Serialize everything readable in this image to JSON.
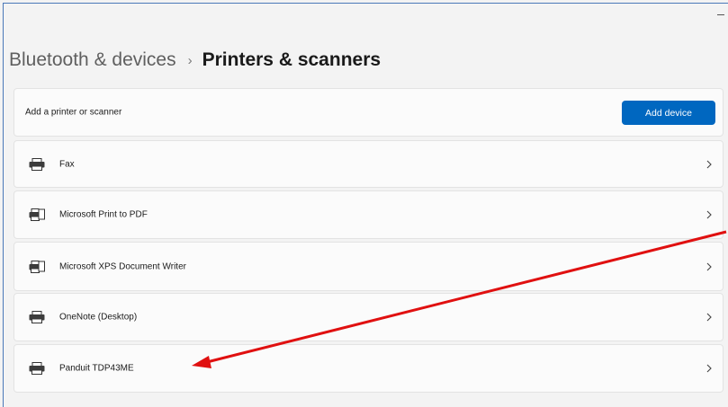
{
  "breadcrumb": {
    "parent": "Bluetooth & devices",
    "separator": "›",
    "current": "Printers & scanners"
  },
  "add_section": {
    "label": "Add a printer or scanner",
    "button_label": "Add device",
    "button_color": "#0067c0"
  },
  "printers": [
    {
      "name": "Fax",
      "icon": "printer-icon"
    },
    {
      "name": "Microsoft Print to PDF",
      "icon": "printer-document-icon"
    },
    {
      "name": "Microsoft XPS Document Writer",
      "icon": "printer-document-icon"
    },
    {
      "name": "OneNote (Desktop)",
      "icon": "printer-icon"
    },
    {
      "name": "Panduit TDP43ME",
      "icon": "printer-icon"
    }
  ],
  "annotation": {
    "arrow_color": "#e01010"
  }
}
